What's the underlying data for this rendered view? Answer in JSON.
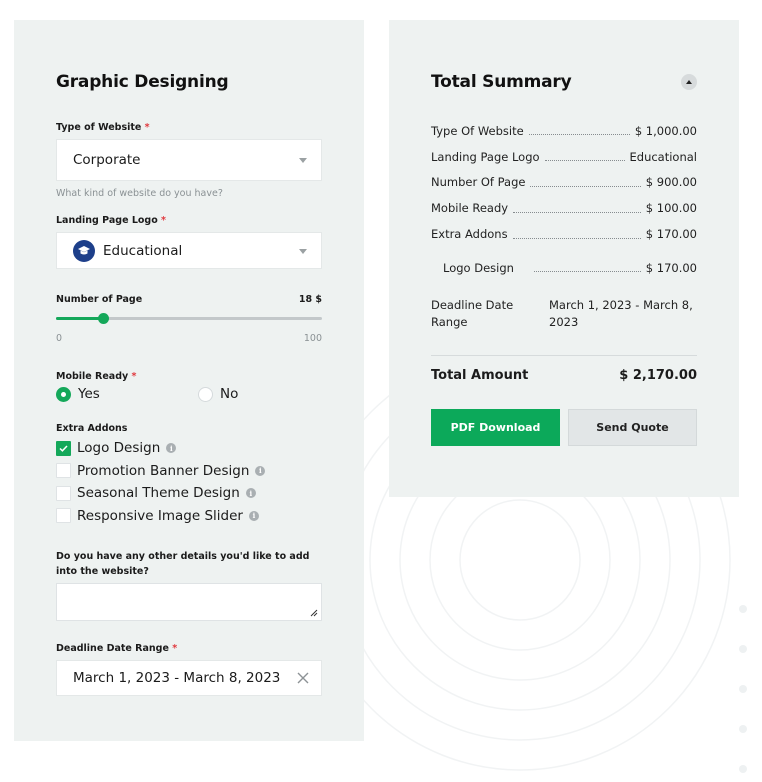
{
  "left": {
    "title": "Graphic Designing",
    "type_of_website": {
      "label": "Type of Website",
      "required_mark": "*",
      "value": "Corporate",
      "hint": "What kind of website do you have?"
    },
    "landing_page_logo": {
      "label": "Landing Page Logo",
      "required_mark": "*",
      "value": "Educational",
      "icon": "graduation-cap-icon"
    },
    "number_of_page": {
      "label": "Number of Page",
      "value_text": "18 $",
      "value": 18,
      "min_label": "0",
      "max_label": "100",
      "min": 0,
      "max": 100
    },
    "mobile_ready": {
      "label": "Mobile Ready",
      "required_mark": "*",
      "options": [
        "Yes",
        "No"
      ],
      "selected": "Yes"
    },
    "extra_addons": {
      "label": "Extra Addons",
      "items": [
        {
          "label": "Logo Design",
          "checked": true
        },
        {
          "label": "Promotion Banner Design",
          "checked": false
        },
        {
          "label": "Seasonal Theme Design",
          "checked": false
        },
        {
          "label": "Responsive Image Slider",
          "checked": false
        }
      ]
    },
    "other_details": {
      "label": "Do you have any other details you'd like to add into the website?",
      "value": ""
    },
    "deadline": {
      "label": "Deadline Date Range",
      "required_mark": "*",
      "value": "March 1, 2023 - March 8, 2023"
    }
  },
  "summary": {
    "title": "Total Summary",
    "rows": [
      {
        "label": "Type Of Website",
        "value": "$ 1,000.00"
      },
      {
        "label": "Landing Page Logo",
        "value": "Educational"
      },
      {
        "label": "Number Of Page",
        "value": "$ 900.00"
      },
      {
        "label": "Mobile Ready",
        "value": "$ 100.00"
      },
      {
        "label": "Extra Addons",
        "value": "$ 170.00"
      }
    ],
    "sub_rows": [
      {
        "label": "Logo Design",
        "value": "$ 170.00"
      }
    ],
    "deadline_label": "Deadline Date Range",
    "deadline_value": "March 1, 2023 - March 8, 2023",
    "total_label": "Total Amount",
    "total_value": "$ 2,170.00",
    "pdf_button": "PDF Download",
    "send_button": "Send Quote"
  },
  "colors": {
    "accent": "#0ca95a",
    "panel_bg": "#eef2f1",
    "required": "#e0393e"
  }
}
